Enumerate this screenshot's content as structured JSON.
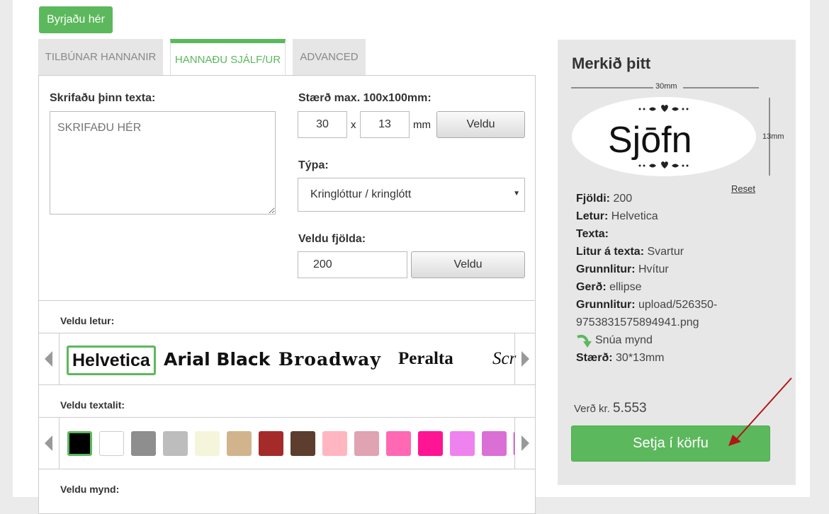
{
  "start_badge": "Byrjaðu hér",
  "tabs": [
    {
      "label": "TILBÚNAR HANNANIR"
    },
    {
      "label": "HANNAÐU SJÁLF/UR"
    },
    {
      "label": "ADVANCED"
    }
  ],
  "text_section": {
    "label": "Skrifaðu þinn texta:",
    "placeholder": "SKRIFAÐU HÉR"
  },
  "size_section": {
    "label": "Stærð max. 100x100mm:",
    "width": "30",
    "x": "x",
    "height": "13",
    "unit": "mm",
    "button": "Veldu"
  },
  "type_section": {
    "label": "Týpa:",
    "selected": "Kringlóttur / kringlótt"
  },
  "quantity_section": {
    "label": "Veldu fjölda:",
    "value": "200",
    "button": "Veldu"
  },
  "font_section": {
    "label": "Veldu letur:",
    "fonts": [
      "Helvetica",
      "Arial Black",
      "Broadway",
      "Peralta",
      "Scr"
    ]
  },
  "color_section": {
    "label": "Veldu textalit:",
    "colors": [
      "#000000",
      "#ffffff",
      "#8e8e8e",
      "#bdbdbd",
      "#f5f5dc",
      "#d2b48c",
      "#a52a2a",
      "#5c3d2e",
      "#ffb6c1",
      "#e0a3b1",
      "#ff69b4",
      "#ff1493",
      "#ee82ee",
      "#da70d6",
      "#d100d1"
    ]
  },
  "image_section": {
    "label": "Veldu mynd:"
  },
  "sidebar": {
    "title": "Merkið þitt",
    "width_label": "30mm",
    "height_label": "13mm",
    "preview_text": "Sjōfn",
    "reset": "Reset",
    "details": [
      {
        "key": "Fjöldi:",
        "value": "200"
      },
      {
        "key": "Letur:",
        "value": "Helvetica"
      },
      {
        "key": "Texta:",
        "value": ""
      },
      {
        "key": "Litur á texta:",
        "value": "Svartur"
      },
      {
        "key": "Grunnlitur:",
        "value": "Hvítur"
      },
      {
        "key": "Gerð:",
        "value": "ellipse"
      },
      {
        "key": "Grunnlitur:",
        "value": "upload/526350-"
      },
      {
        "key": "",
        "value": "9753831575894941.png"
      }
    ],
    "rotate": "Snúa mynd",
    "size_key": "Stærð:",
    "size_value": "30*13mm",
    "price_label": "Verð kr.",
    "price_value": "5.553",
    "cart_button": "Setja í körfu",
    "accent_color": "#5cb85c"
  }
}
